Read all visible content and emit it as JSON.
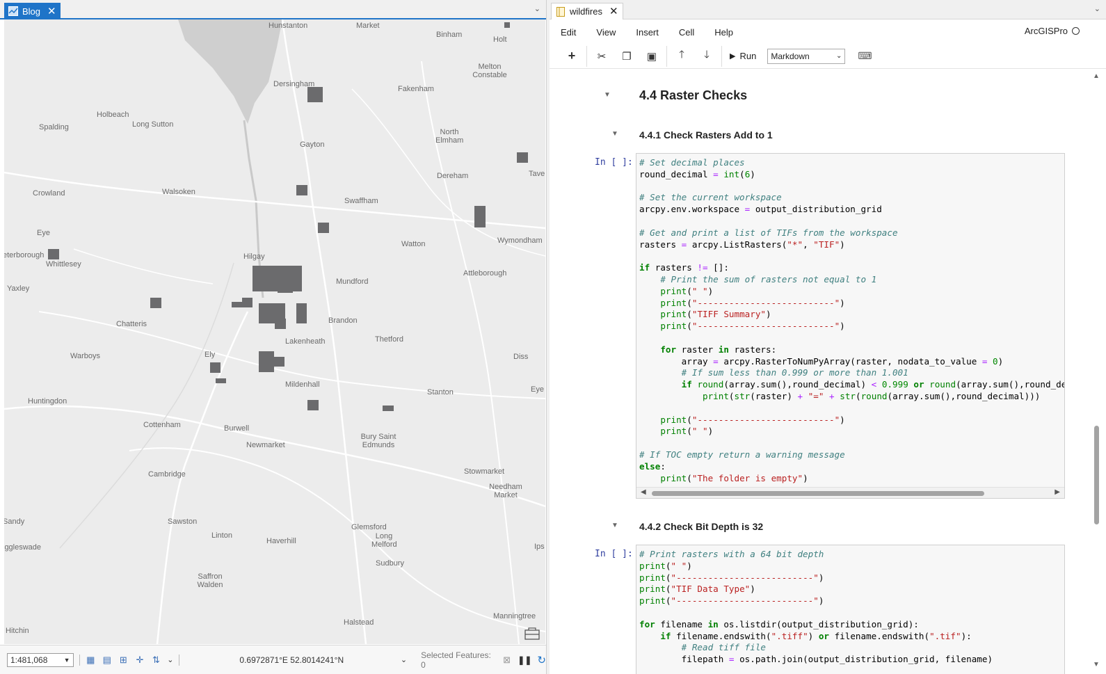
{
  "left_pane": {
    "tab": {
      "title": "Blog",
      "close": "✕"
    },
    "dropdown": "⌄",
    "map": {
      "towns": [
        "Hunstanton",
        "Market",
        "Binham",
        "Holt",
        "Melton Constable",
        "Dersingham",
        "Fakenham",
        "Holbeach",
        "Spalding",
        "Long Sutton",
        "Gayton",
        "North Elmham",
        "Tave",
        "Dereham",
        "Crowland",
        "Walsoken",
        "Swaffham",
        "Wymondham",
        "Eye",
        "Watton",
        "eterborough",
        "Whittlesey",
        "Hilgay",
        "Attleborough",
        "Yaxley",
        "Mundford",
        "Chatteris",
        "Brandon",
        "Thetford",
        "Lakenheath",
        "Warboys",
        "Ely",
        "Diss",
        "Mildenhall",
        "Stanton",
        "Eye",
        "Huntingdon",
        "Cottenham",
        "Burwell",
        "Bury Saint Edmunds",
        "Newmarket",
        "Stowmarket",
        "Cambridge",
        "Needham Market",
        "Sandy",
        "Sawston",
        "Linton",
        "Glemsford",
        "Haverhill",
        "iggleswade",
        "Long Melford",
        "Ips",
        "Sudbury",
        "Saffron Walden",
        "Halstead",
        "Manningtree",
        "Hitchin"
      ]
    },
    "status": {
      "scale": "1:481,068",
      "coords": "0.6972871°E 52.8014241°N",
      "selected": "Selected Features: 0"
    }
  },
  "right_pane": {
    "tab": {
      "title": "wildfires",
      "close": "✕"
    },
    "menu": [
      "Edit",
      "View",
      "Insert",
      "Cell",
      "Help"
    ],
    "kernel": "ArcGISPro",
    "toolbar": {
      "run": "Run",
      "cell_type": "Markdown"
    },
    "notebook": {
      "h1": "4.4 Raster Checks",
      "h2a": "4.4.1 Check Rasters Add to 1",
      "h2b": "4.4.2 Check Bit Depth is 32",
      "prompt": "In [ ]:"
    }
  }
}
